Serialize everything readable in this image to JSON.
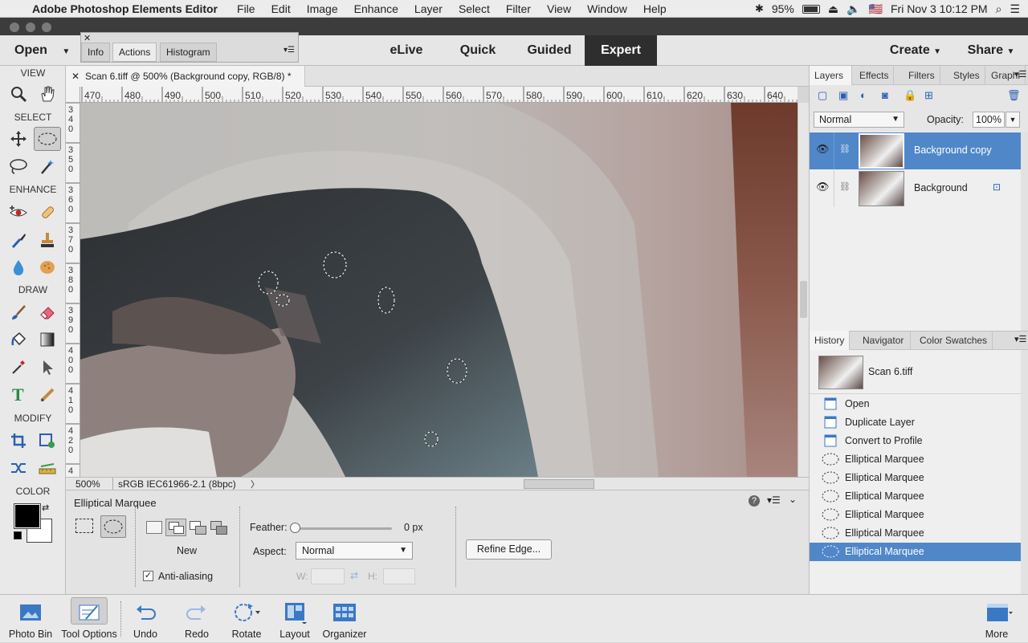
{
  "menubar": {
    "app_name": "Adobe Photoshop Elements Editor",
    "menus": [
      "File",
      "Edit",
      "Image",
      "Enhance",
      "Layer",
      "Select",
      "Filter",
      "View",
      "Window",
      "Help"
    ],
    "battery": "95%",
    "flag": "🇺🇸",
    "clock": "Fri Nov 3  10:12 PM"
  },
  "modebar": {
    "open_label": "Open",
    "modes": [
      "eLive",
      "Quick",
      "Guided",
      "Expert"
    ],
    "active_mode": "Expert",
    "create_label": "Create",
    "share_label": "Share"
  },
  "float_panel": {
    "tabs": [
      "Info",
      "Actions",
      "Histogram"
    ],
    "selected": "Actions"
  },
  "toolbox": {
    "sections": [
      "VIEW",
      "SELECT",
      "ENHANCE",
      "DRAW",
      "MODIFY",
      "COLOR"
    ]
  },
  "document": {
    "tab_title": "Scan 6.tiff @ 500% (Background copy, RGB/8) *",
    "zoom": "500%",
    "profile": "sRGB IEC61966-2.1 (8bpc)",
    "hruler_labels": [
      "470",
      "480",
      "490",
      "500",
      "510",
      "520",
      "530",
      "540",
      "550",
      "560",
      "570",
      "580",
      "590",
      "600",
      "610",
      "620",
      "630",
      "640"
    ],
    "vruler_labels": [
      "340",
      "350",
      "360",
      "370",
      "380",
      "390",
      "400",
      "410",
      "420",
      "4"
    ]
  },
  "tool_options": {
    "tool_name": "Elliptical Marquee",
    "mode_label": "New",
    "anti_alias_label": "Anti-aliasing",
    "anti_alias_checked": true,
    "feather_label": "Feather:",
    "feather_value": "0 px",
    "aspect_label": "Aspect:",
    "aspect_value": "Normal",
    "w_label": "W:",
    "h_label": "H:",
    "refine_label": "Refine Edge..."
  },
  "layers_panel": {
    "tabs": [
      "Layers",
      "Effects",
      "Filters",
      "Styles",
      "Graphi"
    ],
    "blend_mode": "Normal",
    "opacity_label": "Opacity:",
    "opacity_value": "100%",
    "layers": [
      {
        "name": "Background copy",
        "selected": true
      },
      {
        "name": "Background",
        "selected": false
      }
    ]
  },
  "history_panel": {
    "tabs": [
      "History",
      "Navigator",
      "Color Swatches"
    ],
    "snapshot": "Scan 6.tiff",
    "steps": [
      "Open",
      "Duplicate Layer",
      "Convert to Profile",
      "Elliptical Marquee",
      "Elliptical Marquee",
      "Elliptical Marquee",
      "Elliptical Marquee",
      "Elliptical Marquee",
      "Elliptical Marquee"
    ],
    "selected_index": 8
  },
  "bottom_bar": {
    "buttons": [
      "Photo Bin",
      "Tool Options",
      "Undo",
      "Redo",
      "Rotate",
      "Layout",
      "Organizer"
    ],
    "more_label": "More"
  },
  "colors": {
    "accent": "#4a7fc1",
    "selected_row": "#4f87c9",
    "dark_mode_tab": "#2e2e2e"
  }
}
